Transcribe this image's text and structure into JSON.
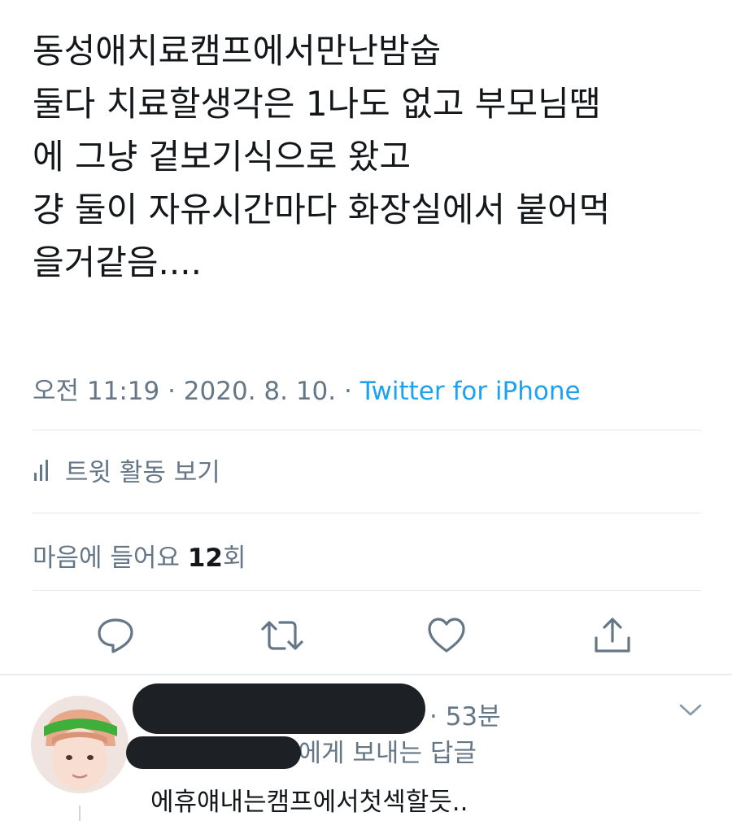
{
  "tweet": {
    "lines": [
      "동성애치료캠프에서만난밤숩",
      "둘다 치료할생각은 1나도 없고 부모님땜",
      "에 그냥 겉보기식으로 왔고",
      "걍 둘이 자유시간마다 화장실에서 붙어먹",
      "을거같음...."
    ],
    "time": "오전 11:19",
    "separator": " · ",
    "date": "2020. 8. 10.",
    "client": "Twitter for iPhone"
  },
  "activity": {
    "label": "트윗 활동 보기",
    "icon": "bar-chart-icon"
  },
  "likes": {
    "prefix": "마음에 들어요 ",
    "count": "12",
    "suffix": "회"
  },
  "actions": [
    {
      "name": "reply",
      "icon": "reply-icon"
    },
    {
      "name": "retweet",
      "icon": "retweet-icon"
    },
    {
      "name": "like",
      "icon": "heart-icon"
    },
    {
      "name": "share",
      "icon": "share-icon"
    }
  ],
  "reply": {
    "time": "· 53분",
    "reply_to_suffix": "님에게 보내는 답글",
    "text": "에휴얘내는캠프에서첫섹할듯..",
    "avatar_headband_color": "#3fae3a"
  },
  "colors": {
    "text": "#14171a",
    "muted": "#657786",
    "accent": "#1da1f2",
    "divider": "#e1e8ed"
  }
}
